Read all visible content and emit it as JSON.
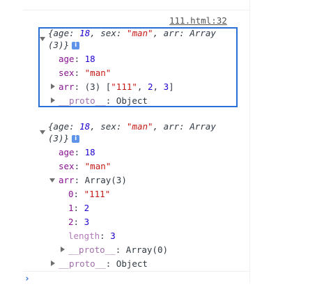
{
  "source_link": "111.html:32",
  "log1": {
    "summary_line1": "{age: 18, sex: \"man\", arr: Array",
    "summary_line2": "(3)}",
    "props": {
      "age_key": "age",
      "age_value": "18",
      "sex_key": "sex",
      "sex_value": "\"man\"",
      "arr_key": "arr",
      "arr_count": "(3)",
      "arr_open": "[",
      "arr_item0": "\"111\"",
      "arr_item1": "2",
      "arr_item2": "3",
      "arr_close": "]",
      "proto_key": "__proto__",
      "proto_value": "Object"
    }
  },
  "log2": {
    "summary_line1": "{age: 18, sex: \"man\", arr: Array",
    "summary_line2": "(3)}",
    "props": {
      "age_key": "age",
      "age_value": "18",
      "sex_key": "sex",
      "sex_value": "\"man\"",
      "arr_key": "arr",
      "arr_value": "Array(3)",
      "items": [
        {
          "key": "0",
          "value": "\"111\""
        },
        {
          "key": "1",
          "value": "2"
        },
        {
          "key": "2",
          "value": "3"
        }
      ],
      "length_key": "length",
      "length_value": "3",
      "arr_proto_key": "__proto__",
      "arr_proto_value": "Array(0)",
      "proto_key": "__proto__",
      "proto_value": "Object"
    }
  },
  "info_icon_glyph": "i",
  "prompt_glyph": "›",
  "colors": {
    "highlight_border": "#2a6fd8",
    "key": "#881391",
    "string": "#c41a16",
    "number": "#1c00cf"
  }
}
